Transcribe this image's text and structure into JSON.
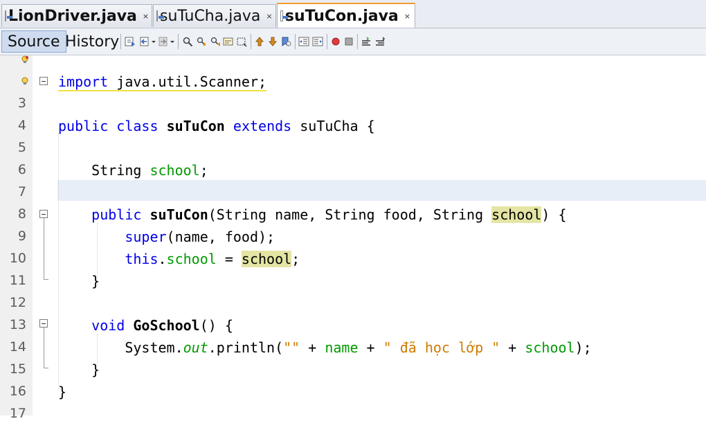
{
  "tabs": [
    {
      "label": "LionDriver.java",
      "close": "×",
      "active": false
    },
    {
      "label": "suTuCha.java",
      "close": "×",
      "active": false
    },
    {
      "label": "suTuCon.java",
      "close": "×",
      "active": true
    }
  ],
  "view_tabs": {
    "source": "Source",
    "history": "History",
    "selected": "Source"
  },
  "toolbar_icons": [
    "last-edit-icon",
    "back-icon",
    "forward-icon",
    "find-selection-icon",
    "find-previous-icon",
    "find-next-icon",
    "toggle-highlight-icon",
    "toggle-rect-select-icon",
    "previous-bookmark-icon",
    "next-bookmark-icon",
    "toggle-bookmark-icon",
    "shift-left-icon",
    "shift-right-icon",
    "start-macro-icon",
    "stop-macro-icon",
    "comment-icon",
    "uncomment-icon"
  ],
  "gutter": {
    "line_numbers": [
      "",
      "",
      "3",
      "4",
      "5",
      "6",
      "7",
      "8",
      "9",
      "10",
      "11",
      "12",
      "13",
      "14",
      "15",
      "16",
      "17"
    ],
    "hint_icons": [
      "lightbulb-warning-icon",
      "lightbulb-warning-icon"
    ]
  },
  "code": {
    "l2": {
      "kw": "import",
      "rest": " java.util.Scanner;"
    },
    "l4": {
      "kw1": "public",
      "kw2": "class",
      "name": "suTuCon",
      "kw3": "extends",
      "rest": " suTuCha {"
    },
    "l6": {
      "type": "String ",
      "field": "school",
      "end": ";"
    },
    "l8": {
      "kw": "public",
      "name": "suTuCon",
      "p1": "(String name, String food, String ",
      "param": "school",
      "end": ") {"
    },
    "l9": {
      "kw": "super",
      "rest": "(name, food);"
    },
    "l10": {
      "kw": "this",
      "dot": ".",
      "field": "school",
      "eq": " = ",
      "param": "school",
      "end": ";"
    },
    "l11": {
      "text": "}"
    },
    "l13": {
      "kw": "void",
      "name": "GoSchool",
      "rest": "() {"
    },
    "l14": {
      "p1": "System.",
      "out": "out",
      "p2": ".println(",
      "s1": "\"\"",
      "p3": " + ",
      "name": "name",
      "p4": " + ",
      "s2": "\" đã học lớp \"",
      "p5": " + ",
      "field": "school",
      "end": ");"
    },
    "l15": {
      "text": "}"
    },
    "l16": {
      "text": "}"
    }
  }
}
